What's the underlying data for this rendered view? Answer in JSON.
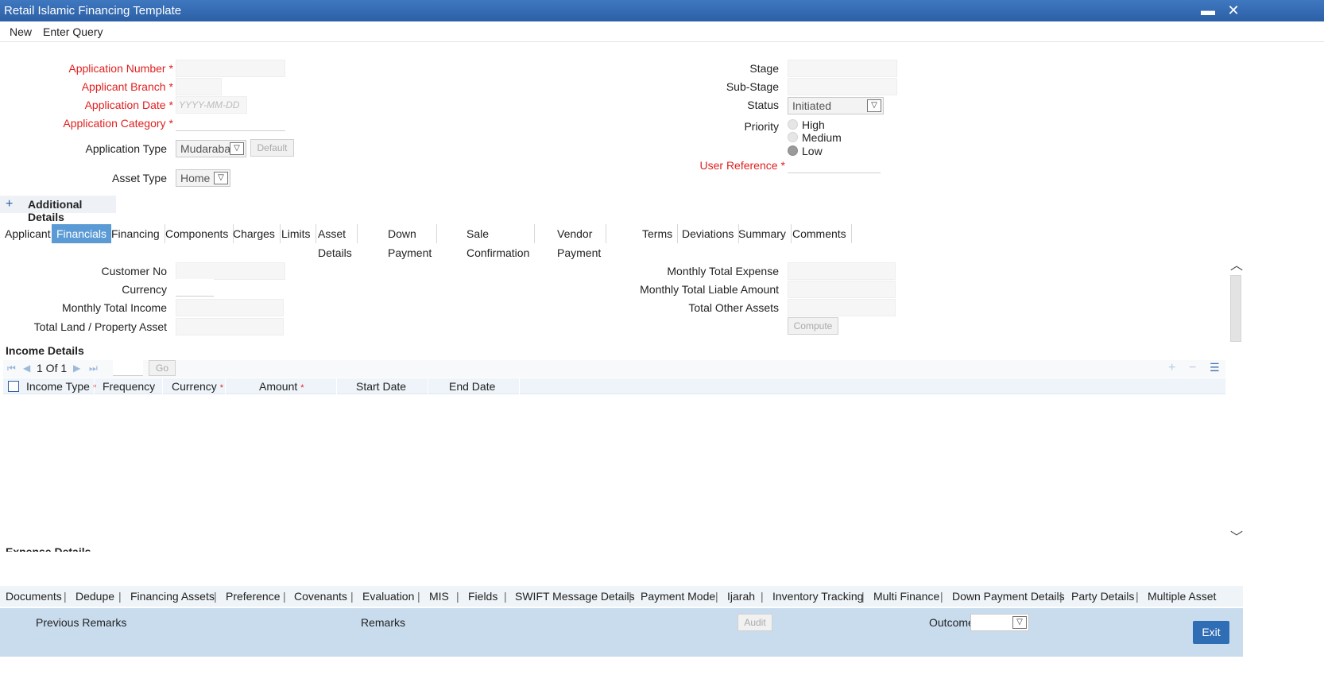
{
  "window": {
    "title": "Retail Islamic Financing Template",
    "min": "▬",
    "close": "✕"
  },
  "menu": {
    "new": "New",
    "enter_query": "Enter Query"
  },
  "header": {
    "application_number": "Application Number",
    "applicant_branch": "Applicant Branch",
    "application_date": "Application Date",
    "application_date_placeholder": "YYYY-MM-DD",
    "application_category": "Application Category",
    "application_type": "Application Type",
    "application_type_value": "Mudarabah",
    "default_btn": "Default",
    "asset_type": "Asset Type",
    "asset_type_value": "Home",
    "stage": "Stage",
    "sub_stage": "Sub-Stage",
    "status": "Status",
    "status_value": "Initiated",
    "priority": "Priority",
    "priority_options": [
      "High",
      "Medium",
      "Low"
    ],
    "priority_selected": "Low",
    "user_reference": "User Reference",
    "required_mark": "*"
  },
  "additional_details": {
    "toggle": "+",
    "label": "Additional Details"
  },
  "tabs": [
    "Applicant",
    "Financials",
    "Financing",
    "Components",
    "Charges",
    "Limits",
    "Asset Details",
    "Down Payment",
    "Sale Confirmation",
    "Vendor Payment",
    "Terms",
    "Deviations",
    "Summary",
    "Comments"
  ],
  "active_tab": "Financials",
  "financials": {
    "customer_no": "Customer No",
    "currency": "Currency",
    "monthly_total_income": "Monthly Total Income",
    "total_land_property_asset": "Total Land / Property Asset",
    "monthly_total_expense": "Monthly Total Expense",
    "monthly_total_liable_amount": "Monthly Total Liable Amount",
    "total_other_assets": "Total Other Assets",
    "compute_btn": "Compute"
  },
  "income_details": {
    "title": "Income Details",
    "pager": "1 Of 1",
    "go": "Go",
    "columns": [
      "Income Type",
      "Frequency",
      "Currency",
      "Amount",
      "Start Date",
      "End Date"
    ],
    "required_cols": [
      "Income Type",
      "Currency",
      "Amount"
    ]
  },
  "next_section_partial": "Expense Details",
  "bottom_links": [
    "Documents",
    "Dedupe",
    "Financing Assets",
    "Preference",
    "Covenants",
    "Evaluation",
    "MIS",
    "Fields",
    "SWIFT Message Details",
    "Payment Mode",
    "Ijarah",
    "Inventory Tracking",
    "Multi Finance",
    "Down Payment Details",
    "Party Details",
    "Multiple Asset"
  ],
  "footer": {
    "previous_remarks": "Previous Remarks",
    "remarks": "Remarks",
    "audit": "Audit",
    "outcome": "Outcome",
    "exit": "Exit"
  },
  "colors": {
    "title_bar": "#2c5fa6",
    "active_tab": "#5b9bd5",
    "required": "#e02020",
    "footer": "#c9dcee",
    "exit_button": "#2f6db5"
  }
}
